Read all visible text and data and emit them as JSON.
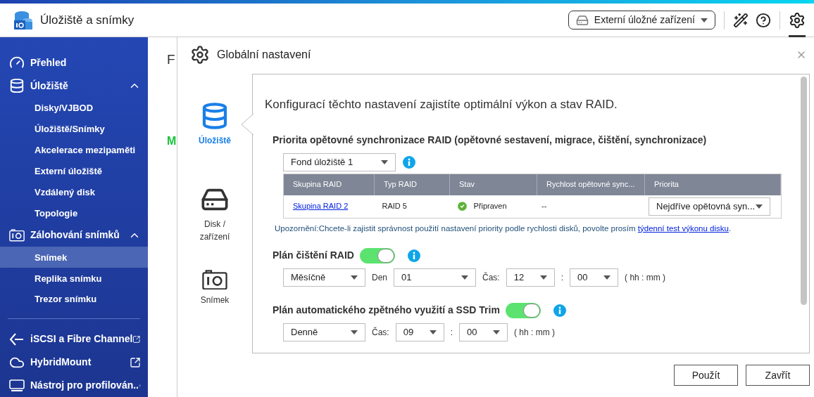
{
  "app": {
    "title": "Úložiště a snímky"
  },
  "header": {
    "device_button": "Externí úložné zařízení"
  },
  "sidebar": {
    "items": [
      {
        "label": "Přehled",
        "expanded": false,
        "external": false
      },
      {
        "label": "Úložiště",
        "expanded": true,
        "external": false,
        "children": [
          {
            "label": "Disky/VJBOD",
            "selected": false
          },
          {
            "label": "Úložiště/Snímky",
            "selected": false
          },
          {
            "label": "Akcelerace mezipaměti",
            "selected": false
          },
          {
            "label": "Externí úložiště",
            "selected": false
          },
          {
            "label": "Vzdálený disk",
            "selected": false
          },
          {
            "label": "Topologie",
            "selected": false
          }
        ]
      },
      {
        "label": "Zálohování snímků",
        "expanded": true,
        "external": false,
        "children": [
          {
            "label": "Snímek",
            "selected": true
          },
          {
            "label": "Replika snímku",
            "selected": false
          },
          {
            "label": "Trezor snímku",
            "selected": false
          }
        ]
      },
      {
        "label": "iSCSI a Fibre Channel",
        "expanded": false,
        "external": true
      },
      {
        "label": "HybridMount",
        "expanded": false,
        "external": true
      },
      {
        "label": "Nástroj pro profilován..",
        "expanded": false,
        "external": true
      }
    ]
  },
  "background": {
    "heading": "F",
    "status": "M"
  },
  "dialog": {
    "title": "Globální nastavení",
    "tabs": [
      {
        "label": "Úložiště",
        "selected": true
      },
      {
        "label": "Disk / zařízení",
        "selected": false
      },
      {
        "label": "Snímek",
        "selected": false
      }
    ],
    "intro": "Konfigurací těchto nastavení zajistíte optimální výkon a stav RAID.",
    "resync": {
      "title": "Priorita opětovné synchronizace RAID (opětovné sestavení, migrace, čištění, synchronizace)",
      "pool_select": "Fond úložiště 1",
      "columns": [
        "Skupina RAID",
        "Typ RAID",
        "Stav",
        "Rychlost opětovné sync...",
        "Priorita"
      ],
      "rows": [
        {
          "group": "Skupina RAID 2",
          "type": "RAID 5",
          "status": "Připraven",
          "speed": "--",
          "priority": "Nejdříve opětovná syn..."
        }
      ],
      "notice": "Upozornění:Chcete-li zajistit správnost použití nastavení priority podle rychlosti disků, povolte prosím ",
      "notice_link": "týdenní test výkonu disku",
      "notice_end": "."
    },
    "schedules": [
      {
        "title": "Plán čištění RAID",
        "on": true,
        "fields": [
          {
            "kind": "select",
            "value": "Měsíčně"
          },
          {
            "kind": "label",
            "text": "Den"
          },
          {
            "kind": "select",
            "value": "01"
          },
          {
            "kind": "label",
            "text": "Čas:"
          },
          {
            "kind": "time_select",
            "value": "12"
          },
          {
            "kind": "label",
            "text": ":"
          },
          {
            "kind": "time_select",
            "value": "00"
          },
          {
            "kind": "label",
            "text": "( hh : mm )"
          }
        ]
      },
      {
        "title": "Plán automatického zpětného využití a SSD Trim",
        "on": true,
        "fields": [
          {
            "kind": "select",
            "value": "Denně"
          },
          {
            "kind": "label",
            "text": "Čas:"
          },
          {
            "kind": "time_select",
            "value": "09"
          },
          {
            "kind": "label",
            "text": ":"
          },
          {
            "kind": "time_select",
            "value": "00"
          },
          {
            "kind": "label",
            "text": "( hh : mm )"
          }
        ]
      }
    ],
    "buttons": [
      "Použít",
      "Zavřít"
    ]
  }
}
